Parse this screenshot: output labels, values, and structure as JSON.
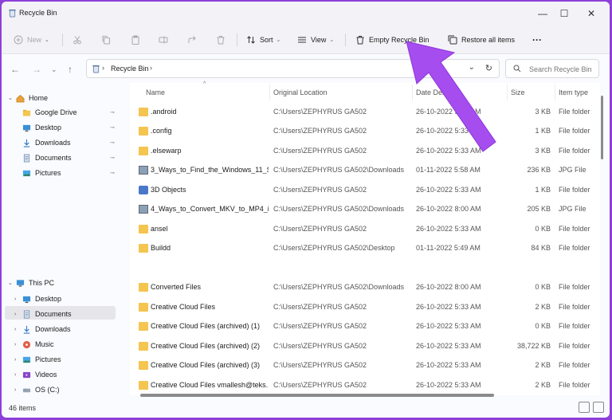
{
  "window": {
    "title": "Recycle Bin"
  },
  "window_controls": {
    "minimize": "—",
    "maximize": "☐",
    "close": "✕"
  },
  "toolbar": {
    "new_label": "New",
    "sort_label": "Sort",
    "view_label": "View",
    "empty_label": "Empty Recycle Bin",
    "restore_label": "Restore all items",
    "more_label": "···"
  },
  "address": {
    "path": "Recycle Bin",
    "separator": "›"
  },
  "search": {
    "placeholder": "Search Recycle Bin"
  },
  "sidebar": {
    "home": "Home",
    "quick_access": [
      {
        "label": "Google Drive",
        "icon": "folder-icon"
      },
      {
        "label": "Desktop",
        "icon": "desktop-icon"
      },
      {
        "label": "Downloads",
        "icon": "downloads-icon"
      },
      {
        "label": "Documents",
        "icon": "documents-icon"
      },
      {
        "label": "Pictures",
        "icon": "pictures-icon"
      }
    ],
    "this_pc": "This PC",
    "pc_items": [
      {
        "label": "Desktop",
        "icon": "desktop-icon"
      },
      {
        "label": "Documents",
        "icon": "documents-icon"
      },
      {
        "label": "Downloads",
        "icon": "downloads-icon"
      },
      {
        "label": "Music",
        "icon": "music-icon"
      },
      {
        "label": "Pictures",
        "icon": "pictures-icon"
      },
      {
        "label": "Videos",
        "icon": "videos-icon"
      },
      {
        "label": "OS (C:)",
        "icon": "drive-icon"
      }
    ]
  },
  "columns": {
    "name": "Name",
    "location": "Original Location",
    "date": "Date Deleted",
    "size": "Size",
    "type": "Item type"
  },
  "rows": [
    {
      "name": ".android",
      "location": "C:\\Users\\ZEPHYRUS GA502",
      "date": "26-10-2022 5:33 AM",
      "size": "3 KB",
      "type": "File folder",
      "icon": "folder"
    },
    {
      "name": ".config",
      "location": "C:\\Users\\ZEPHYRUS GA502",
      "date": "26-10-2022 5:33 AM",
      "size": "1 KB",
      "type": "File folder",
      "icon": "folder"
    },
    {
      "name": ".elsewarp",
      "location": "C:\\Users\\ZEPHYRUS GA502",
      "date": "26-10-2022 5:33 AM",
      "size": "3 KB",
      "type": "File folder",
      "icon": "folder"
    },
    {
      "name": "3_Ways_to_Find_the_Windows_11_S...",
      "location": "C:\\Users\\ZEPHYRUS GA502\\Downloads",
      "date": "01-11-2022 5:58 AM",
      "size": "236 KB",
      "type": "JPG File",
      "icon": "jpg"
    },
    {
      "name": "3D Objects",
      "location": "C:\\Users\\ZEPHYRUS GA502",
      "date": "26-10-2022 5:33 AM",
      "size": "1 KB",
      "type": "File folder",
      "icon": "obj3d"
    },
    {
      "name": "4_Ways_to_Convert_MKV_to_MP4_i...",
      "location": "C:\\Users\\ZEPHYRUS GA502\\Downloads",
      "date": "26-10-2022 8:00 AM",
      "size": "205 KB",
      "type": "JPG File",
      "icon": "jpg"
    },
    {
      "name": "ansel",
      "location": "C:\\Users\\ZEPHYRUS GA502",
      "date": "26-10-2022 5:33 AM",
      "size": "0 KB",
      "type": "File folder",
      "icon": "folder"
    },
    {
      "name": "Buildd",
      "location": "C:\\Users\\ZEPHYRUS GA502\\Desktop",
      "date": "01-11-2022 5:49 AM",
      "size": "84 KB",
      "type": "File folder",
      "icon": "folder"
    },
    {
      "name": "",
      "location": "",
      "date": "",
      "size": "",
      "type": "",
      "icon": ""
    },
    {
      "name": "Converted Files",
      "location": "C:\\Users\\ZEPHYRUS GA502\\Downloads",
      "date": "26-10-2022 8:00 AM",
      "size": "0 KB",
      "type": "File folder",
      "icon": "folder"
    },
    {
      "name": "Creative Cloud Files",
      "location": "C:\\Users\\ZEPHYRUS GA502",
      "date": "26-10-2022 5:33 AM",
      "size": "2 KB",
      "type": "File folder",
      "icon": "ccf"
    },
    {
      "name": "Creative Cloud Files (archived) (1)",
      "location": "C:\\Users\\ZEPHYRUS GA502",
      "date": "26-10-2022 5:33 AM",
      "size": "0 KB",
      "type": "File folder",
      "icon": "folder"
    },
    {
      "name": "Creative Cloud Files (archived) (2)",
      "location": "C:\\Users\\ZEPHYRUS GA502",
      "date": "26-10-2022 5:33 AM",
      "size": "38,722 KB",
      "type": "File folder",
      "icon": "ccf"
    },
    {
      "name": "Creative Cloud Files (archived) (3)",
      "location": "C:\\Users\\ZEPHYRUS GA502",
      "date": "26-10-2022 5:33 AM",
      "size": "2 KB",
      "type": "File folder",
      "icon": "ccf"
    },
    {
      "name": "Creative Cloud Files vmallesh@teks...",
      "location": "C:\\Users\\ZEPHYRUS GA502",
      "date": "26-10-2022 5:33 AM",
      "size": "2 KB",
      "type": "File folder",
      "icon": "ccf"
    }
  ],
  "status": {
    "count": "46 items"
  },
  "colors": {
    "background": "#8d3fd8",
    "arrow": "#a64df0",
    "folder": "#f4c54f"
  }
}
